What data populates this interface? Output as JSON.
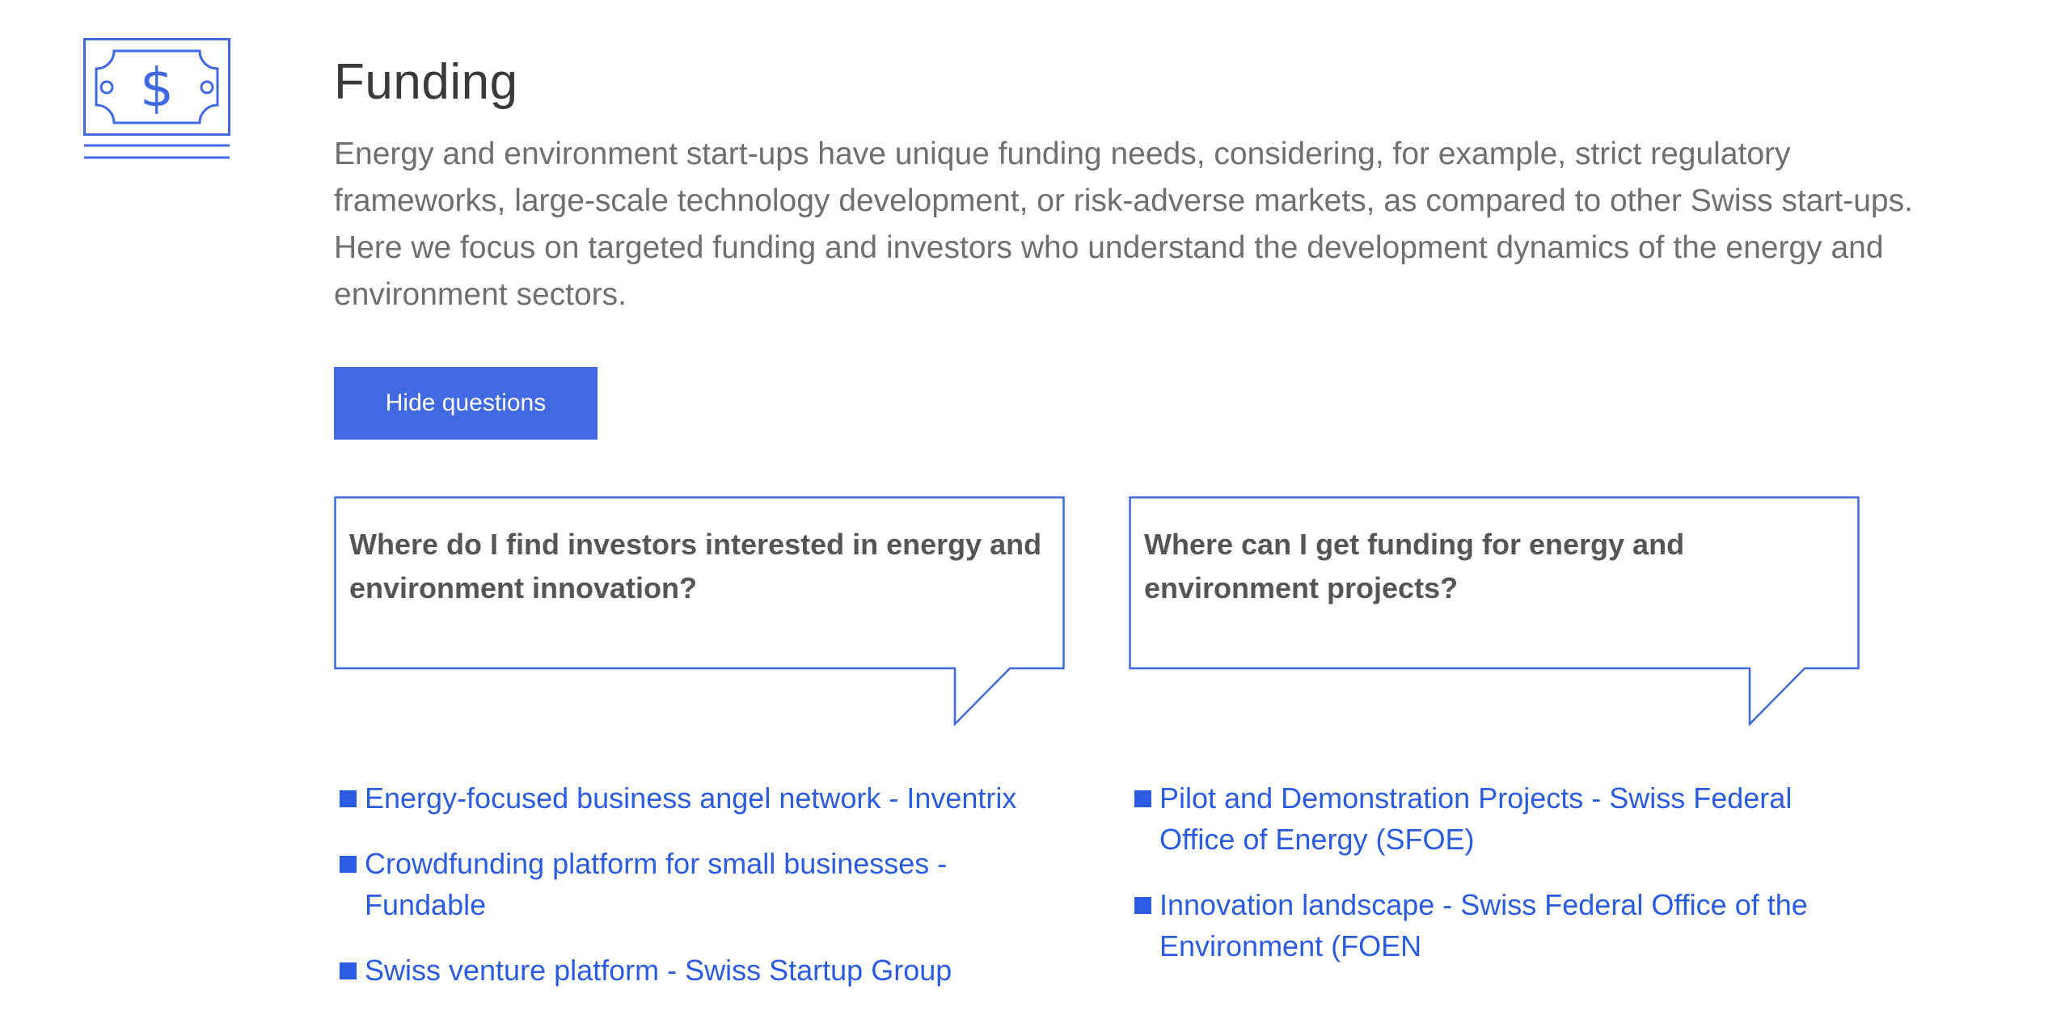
{
  "section": {
    "icon": "money-bill-icon",
    "title": "Funding",
    "intro": "Energy and environment start-ups have unique funding needs, considering, for example, strict regulatory frameworks, large-scale technology development, or risk-adverse markets, as compared to other Swiss start-ups. Here we focus on targeted funding and investors who understand the development dynamics of the energy and environment sectors.",
    "toggle_label": "Hide questions"
  },
  "questions": [
    {
      "question": "Where do I find investors interested in energy and environment innovation?",
      "links": [
        "Energy-focused business angel network - Inventrix",
        "Crowdfunding platform for small businesses - Fundable",
        "Swiss venture platform - Swiss Startup Group"
      ]
    },
    {
      "question": "Where can I get funding for energy and environment projects?",
      "links": [
        "Pilot and Demonstration Projects - Swiss Federal Office of Energy (SFOE)",
        "Innovation landscape - Swiss Federal Office of the Environment (FOEN"
      ]
    }
  ],
  "colors": {
    "accent": "#4169e1",
    "link": "#2b5be0",
    "text_muted": "#6f6f6f"
  }
}
